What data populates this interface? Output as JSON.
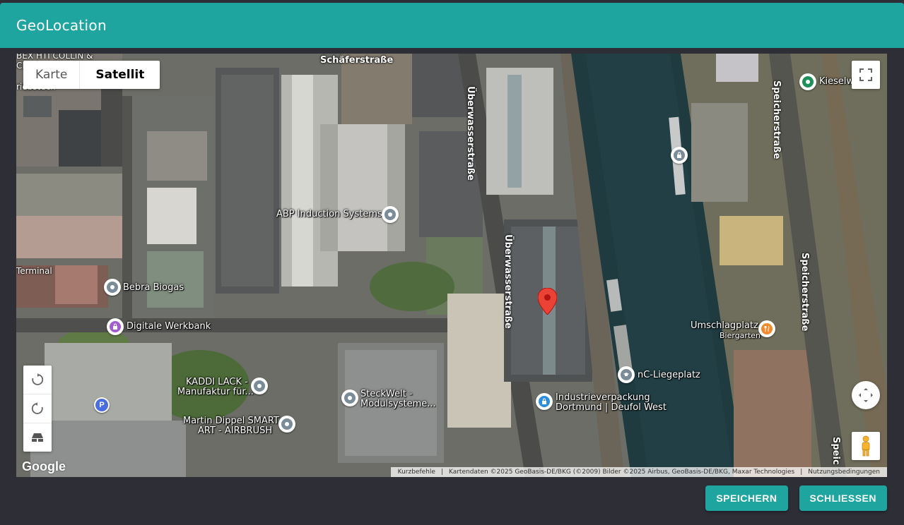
{
  "dialog": {
    "title": "GeoLocation"
  },
  "map": {
    "type_control": {
      "map_label": "Karte",
      "satellite_label": "Satellit",
      "selected": "Satellit"
    },
    "streets": [
      {
        "id": "schaefer",
        "name": "Schäferstraße"
      },
      {
        "id": "ueberwasser1",
        "name": "Überwasserstraße"
      },
      {
        "id": "ueberwasser2",
        "name": "Überwasserstraße"
      },
      {
        "id": "speicher1",
        "name": "Speicherstraße"
      },
      {
        "id": "speicher2",
        "name": "Speicherstraße"
      },
      {
        "id": "speicher3",
        "name": "Speic"
      }
    ],
    "places": {
      "abp": "ABP Induction Systems",
      "bebra": "Bebra Biogas",
      "digitale": "Digitale Werkbank",
      "kaddi_1": "KADDI LACK -",
      "kaddi_2": "Manufaktur für...",
      "steck_1": "SteckWelt -",
      "steck_2": "Modulsysteme...",
      "dippel_1": "Martin Dippel SMART",
      "dippel_2": "ART - AIRBRUSH",
      "industrie_1": "Industrieverpackung",
      "industrie_2": "Dortmund | Deufol West",
      "liegeplatz": "nC-Liegeplatz",
      "umschlag": "Umschlagplatz",
      "biergarten": "Biergarten",
      "kiesel": "Kieselw",
      "terminal": "Terminal",
      "top_left_1": "BEX HTI COLLIN &",
      "top_left_2": "CH",
      "top_left_3": "riebstech"
    },
    "attribution": {
      "shortcuts": "Kurzbefehle",
      "data": "Kartendaten ©2025 GeoBasis-DE/BKG (©2009) Bilder ©2025 Airbus, GeoBasis-DE/BKG, Maxar Technologies",
      "terms": "Nutzungsbedingungen"
    },
    "logo": "Google"
  },
  "actions": {
    "save": "SPEICHERN",
    "close": "SCHLIESSEN"
  },
  "colors": {
    "header": "#1fa5a0",
    "background": "#2d2e36",
    "marker": "#ea4335",
    "water": "#1f3b40"
  },
  "icons": [
    "fullscreen-icon",
    "camera-control-icon",
    "pegman-icon",
    "rotate-clockwise-icon",
    "rotate-counterclockwise-icon",
    "tilt-icon",
    "map-marker-icon"
  ]
}
